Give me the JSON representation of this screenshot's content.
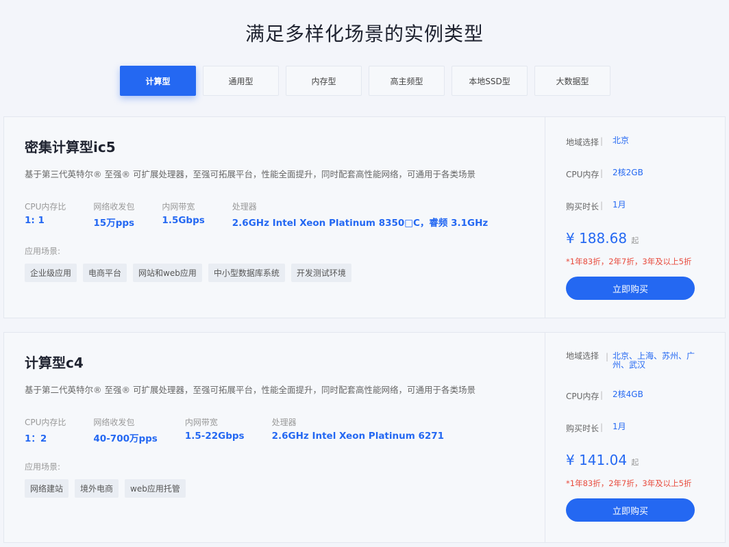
{
  "page": {
    "title": "满足多样化场景的实例类型"
  },
  "tabs": [
    {
      "label": "计算型",
      "active": true
    },
    {
      "label": "通用型"
    },
    {
      "label": "内存型"
    },
    {
      "label": "高主频型"
    },
    {
      "label": "本地SSD型"
    },
    {
      "label": "大数据型"
    }
  ],
  "instances": [
    {
      "title": "密集计算型ic5",
      "desc": "基于第三代英特尔® 至强® 可扩展处理器，至强可拓展平台，性能全面提升，同时配套高性能网络，可通用于各类场景",
      "specs": [
        {
          "label": "CPU内存比",
          "value": "1: 1"
        },
        {
          "label": "网络收发包",
          "value": "15万pps"
        },
        {
          "label": "内网带宽",
          "value": "1.5Gbps"
        },
        {
          "label": "处理器",
          "value": "2.6GHz Intel Xeon Platinum 8350□C，睿频 3.1GHz"
        }
      ],
      "scene_label": "应用场景:",
      "tags": [
        "企业级应用",
        "电商平台",
        "网站和web应用",
        "中小型数据库系统",
        "开发测试环境"
      ],
      "region_label": "地域选择",
      "region": "北京",
      "cpu_label": "CPU内存",
      "cpu": "2核2GB",
      "duration_label": "购买时长",
      "duration": "1月",
      "price": "¥ 188.68",
      "price_unit": "起",
      "discount": "*1年83折，2年7折，3年及以上5折",
      "buy_label": "立即购买"
    },
    {
      "title": "计算型c4",
      "desc": "基于第二代英特尔® 至强® 可扩展处理器，至强可拓展平台，性能全面提升，同时配套高性能网络，可通用于各类场景",
      "specs": [
        {
          "label": "CPU内存比",
          "value": "1：2"
        },
        {
          "label": "网络收发包",
          "value": "40-700万pps"
        },
        {
          "label": "内网带宽",
          "value": "1.5-22Gbps"
        },
        {
          "label": "处理器",
          "value": "2.6GHz Intel Xeon Platinum 6271"
        }
      ],
      "scene_label": "应用场景:",
      "tags": [
        "网络建站",
        "境外电商",
        "web应用托管"
      ],
      "region_label": "地域选择",
      "region": "北京、上海、苏州、广州、武汉",
      "cpu_label": "CPU内存",
      "cpu": "2核4GB",
      "duration_label": "购买时长",
      "duration": "1月",
      "price": "¥ 141.04",
      "price_unit": "起",
      "discount": "*1年83折，2年7折，3年及以上5折",
      "buy_label": "立即购买"
    }
  ]
}
